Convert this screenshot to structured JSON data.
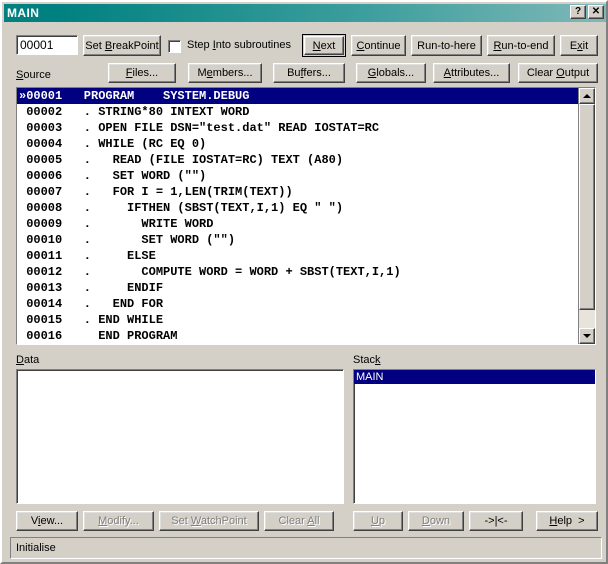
{
  "window": {
    "title": "MAIN",
    "titlebar_buttons": [
      {
        "name": "help-button",
        "label": "?"
      },
      {
        "name": "close-button",
        "label": "✕"
      }
    ]
  },
  "toolbar": {
    "line_number_value": "00001",
    "set_breakpoint_label": "Set BreakPoint",
    "set_breakpoint_accel": "B",
    "step_into_label": "Step Into subroutines",
    "step_into_accel": "I",
    "step_into_checked": false,
    "next_label": "Next",
    "next_accel": "N",
    "continue_label": "Continue",
    "continue_accel": "C",
    "run_to_here_label": "Run-to-here",
    "run_to_here_accel": "R",
    "run_to_end_label": "Run-to-end",
    "run_to_end_accel": "R",
    "exit_label": "Exit",
    "exit_accel": "x"
  },
  "toolbar2": {
    "files_label": "Files...",
    "files_accel": "F",
    "members_label": "Members...",
    "members_accel": "e",
    "buffers_label": "Buffers...",
    "buffers_accel": "f",
    "globals_label": "Globals...",
    "globals_accel": "G",
    "attributes_label": "Attributes...",
    "attributes_accel": "A",
    "clear_output_label": "Clear Output",
    "clear_output_accel": "O"
  },
  "source": {
    "label": "Source",
    "label_accel": "S",
    "current_marker": "»",
    "lines": [
      {
        "num": "00001",
        "text": "PROGRAM    SYSTEM.DEBUG",
        "current": true
      },
      {
        "num": "00002",
        "text": ". STRING*80 INTEXT WORD",
        "current": false
      },
      {
        "num": "00003",
        "text": ". OPEN FILE DSN=\"test.dat\" READ IOSTAT=RC",
        "current": false
      },
      {
        "num": "00004",
        "text": ". WHILE (RC EQ 0)",
        "current": false
      },
      {
        "num": "00005",
        "text": ".   READ (FILE IOSTAT=RC) TEXT (A80)",
        "current": false
      },
      {
        "num": "00006",
        "text": ".   SET WORD (\"\")",
        "current": false
      },
      {
        "num": "00007",
        "text": ".   FOR I = 1,LEN(TRIM(TEXT))",
        "current": false
      },
      {
        "num": "00008",
        "text": ".     IFTHEN (SBST(TEXT,I,1) EQ \" \")",
        "current": false
      },
      {
        "num": "00009",
        "text": ".       WRITE WORD",
        "current": false
      },
      {
        "num": "00010",
        "text": ".       SET WORD (\"\")",
        "current": false
      },
      {
        "num": "00011",
        "text": ".     ELSE",
        "current": false
      },
      {
        "num": "00012",
        "text": ".       COMPUTE WORD = WORD + SBST(TEXT,I,1)",
        "current": false
      },
      {
        "num": "00013",
        "text": ".     ENDIF",
        "current": false
      },
      {
        "num": "00014",
        "text": ".   END FOR",
        "current": false
      },
      {
        "num": "00015",
        "text": ". END WHILE",
        "current": false
      },
      {
        "num": "00016",
        "text": "  END PROGRAM",
        "current": false
      }
    ]
  },
  "data_panel": {
    "label": "Data",
    "label_accel": "D",
    "rows": []
  },
  "stack_panel": {
    "label": "Stack",
    "label_accel": "k",
    "rows": [
      {
        "text": "MAIN",
        "selected": true
      }
    ]
  },
  "bottom_buttons": {
    "view_label": "View...",
    "view_accel": "i",
    "view_enabled": true,
    "modify_label": "Modify...",
    "modify_accel": "M",
    "modify_enabled": false,
    "set_watchpoint_label": "Set WatchPoint",
    "set_watchpoint_accel": "W",
    "set_watchpoint_enabled": false,
    "clear_all_label": "Clear All",
    "clear_all_accel": "A",
    "clear_all_enabled": false,
    "up_label": "Up",
    "up_accel": "U",
    "up_enabled": false,
    "down_label": "Down",
    "down_accel": "D",
    "down_enabled": false,
    "center_label": "->|<-",
    "center_enabled": true,
    "help_label": "Help  >",
    "help_accel": "H",
    "help_enabled": true
  },
  "statusbar": {
    "text": "Initialise"
  },
  "colors": {
    "face": "#d4d0c8",
    "title_start": "#008080",
    "title_end": "#7fb8b8",
    "selection": "#000080",
    "disabled_text": "#808080"
  }
}
